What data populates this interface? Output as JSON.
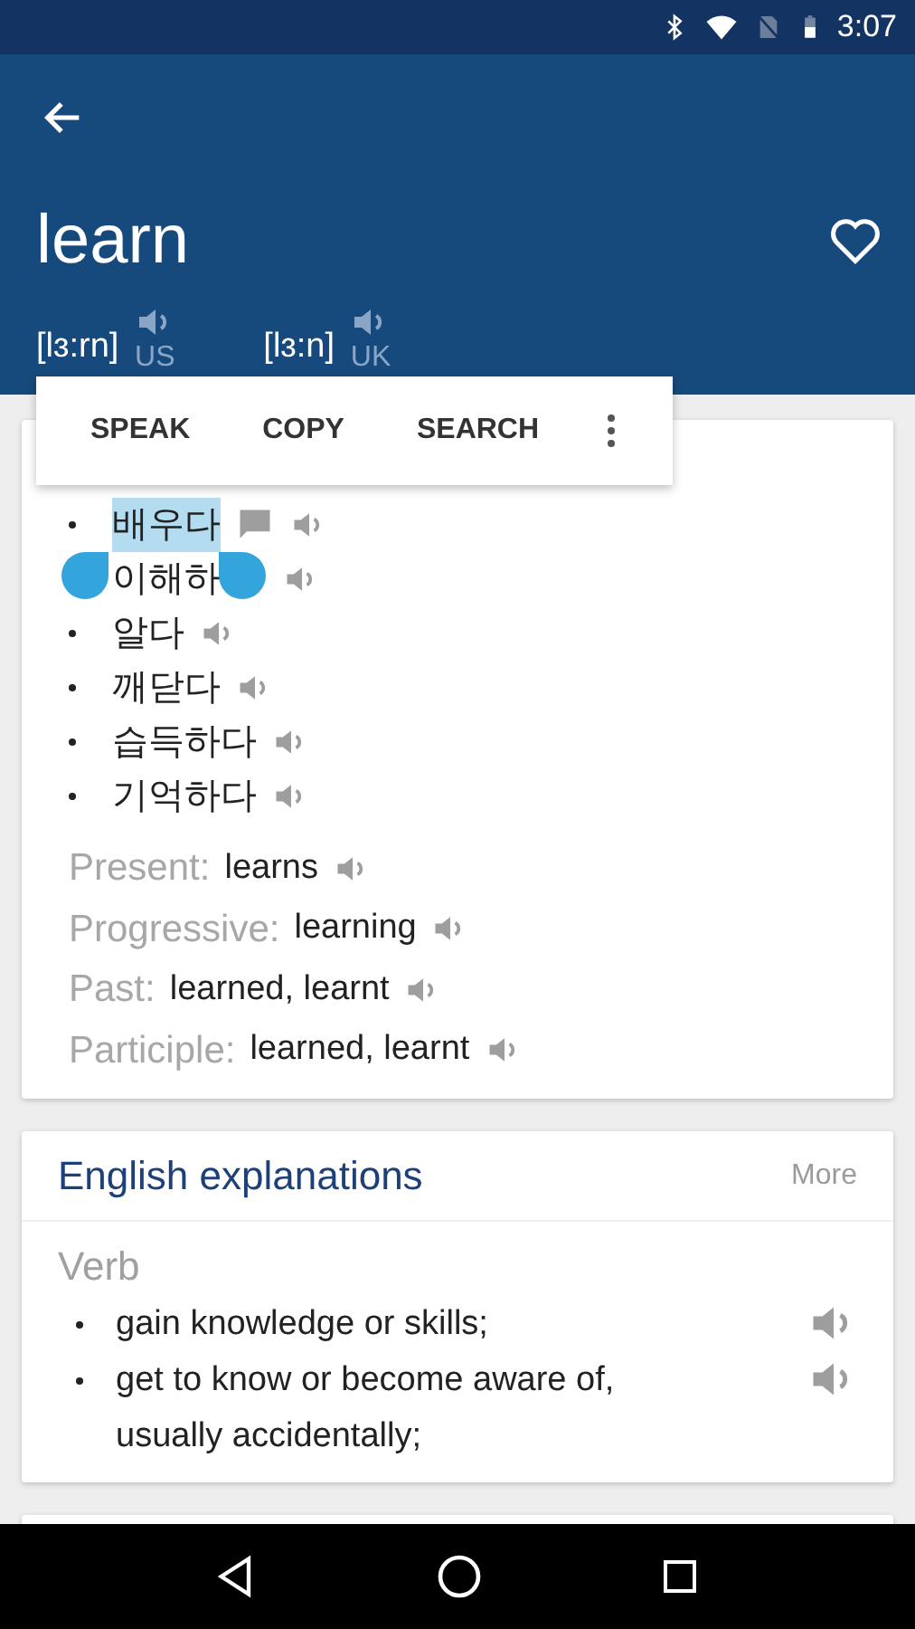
{
  "status_bar": {
    "time": "3:07"
  },
  "header": {
    "word": "learn",
    "favorite": false,
    "pronunciations": [
      {
        "ipa": "[lɜ:rn]",
        "region": "US"
      },
      {
        "ipa": "[lɜ:n]",
        "region": "UK"
      }
    ]
  },
  "text_menu": {
    "actions": [
      "SPEAK",
      "COPY",
      "SEARCH"
    ]
  },
  "meanings": [
    {
      "text": "배우다",
      "selected": true
    },
    {
      "text": "이해하",
      "selected": false
    },
    {
      "text": "알다",
      "selected": false
    },
    {
      "text": "깨닫다",
      "selected": false
    },
    {
      "text": "습득하다",
      "selected": false
    },
    {
      "text": "기억하다",
      "selected": false
    }
  ],
  "forms": [
    {
      "label": "Present:",
      "value": "learns"
    },
    {
      "label": "Progressive:",
      "value": "learning"
    },
    {
      "label": "Past:",
      "value": "learned, learnt"
    },
    {
      "label": "Participle:",
      "value": "learned, learnt"
    }
  ],
  "explanations": {
    "title": "English explanations",
    "more": "More",
    "part_of_speech": "Verb",
    "definitions": [
      "gain knowledge or skills;",
      "get to know or become aware of, usually accidentally;"
    ]
  }
}
